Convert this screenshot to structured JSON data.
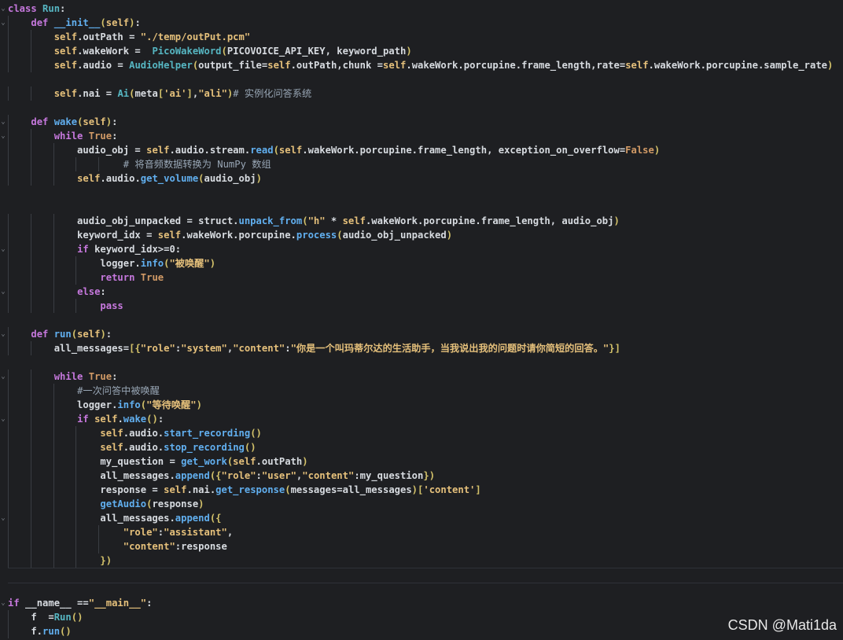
{
  "lines": [
    "class Run:",
    "    def __init__(self):",
    "        self.outPath = \"./temp/outPut.pcm\"",
    "        self.wakeWork =  PicoWakeWord(PICOVOICE_API_KEY, keyword_path)",
    "        self.audio = AudioHelper(output_file=self.outPath,chunk =self.wakeWork.porcupine.frame_length,rate=self.wakeWork.porcupine.sample_rate)",
    "",
    "        self.nai = Ai(meta['ai'],\"ali\")# 实例化问答系统",
    "",
    "    def wake(self):",
    "        while True:",
    "            audio_obj = self.audio.stream.read(self.wakeWork.porcupine.frame_length, exception_on_overflow=False)",
    "                    # 将音频数据转换为 NumPy 数组",
    "            self.audio.get_volume(audio_obj)",
    "",
    "",
    "            audio_obj_unpacked = struct.unpack_from(\"h\" * self.wakeWork.porcupine.frame_length, audio_obj)",
    "            keyword_idx = self.wakeWork.porcupine.process(audio_obj_unpacked)",
    "            if keyword_idx>=0:",
    "                logger.info(\"被唤醒\")",
    "                return True",
    "            else:",
    "                pass",
    "",
    "    def run(self):",
    "        all_messages=[{\"role\":\"system\",\"content\":\"你是一个叫玛蒂尔达的生活助手，当我说出我的问题时请你简短的回答。\"}]",
    "",
    "        while True:",
    "            #一次问答中被唤醒",
    "            logger.info(\"等待唤醒\")",
    "            if self.wake():",
    "                self.audio.start_recording()",
    "                self.audio.stop_recording()",
    "                my_question = get_work(self.outPath)",
    "                all_messages.append({\"role\":\"user\",\"content\":my_question})",
    "                response = self.nai.get_response(messages=all_messages)['content']",
    "                getAudio(response)",
    "                all_messages.append({",
    "                    \"role\":\"assistant\",",
    "                    \"content\":response",
    "                })",
    "",
    "",
    "if __name__ ==\"__main__\":",
    "    f  =Run()",
    "    f.run()"
  ],
  "watermark": "CSDN @Mati1da",
  "colors": {
    "background": "#1e1f22",
    "keyword": "#c678dd",
    "function": "#61afef",
    "string": "#e5c07b",
    "comment": "#98a6b5"
  }
}
